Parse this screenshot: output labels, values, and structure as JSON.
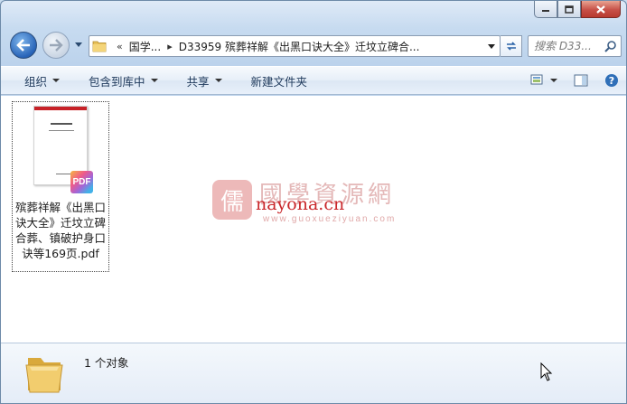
{
  "window": {
    "caption_buttons": [
      "minimize",
      "maximize",
      "close"
    ]
  },
  "address_bar": {
    "overflow_label": "«",
    "segments": [
      "国学...",
      "D33959 殡葬祥解《出黑口诀大全》迁坟立碑合..."
    ]
  },
  "search": {
    "placeholder": "搜索 D33..."
  },
  "toolbar": {
    "organize": "组织",
    "include_in_library": "包含到库中",
    "share": "共享",
    "new_folder": "新建文件夹"
  },
  "files": [
    {
      "name": "殡葬祥解《出黑口诀大全》迁坟立碑合葬、镇破护身口诀等169页.pdf",
      "badge": "PDF",
      "icon": "pdf-file-icon"
    }
  ],
  "watermark": {
    "title": "國學資源網",
    "domain": "nayona.cn",
    "url": "www.guoxueziyuan.com"
  },
  "details": {
    "status": "1 个对象"
  },
  "colors": {
    "accent": "#2864b8",
    "close_button": "#c75047",
    "watermark_red": "#c9262a"
  }
}
